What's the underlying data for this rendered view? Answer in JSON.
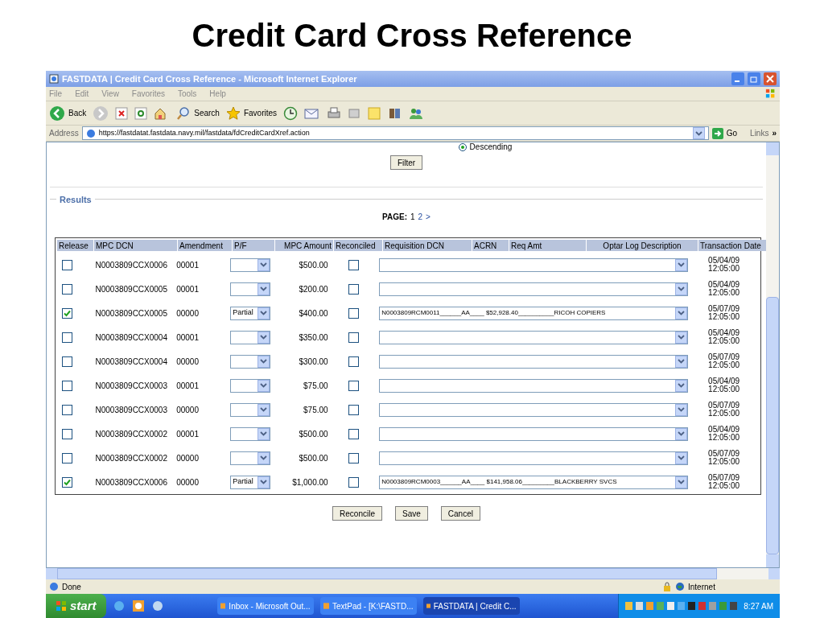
{
  "slide_title": "Credit Card Cross Reference",
  "window": {
    "title": "FASTDATA | Credit Card Cross Reference - Microsoft Internet Explorer"
  },
  "menu": [
    "File",
    "Edit",
    "View",
    "Favorites",
    "Tools",
    "Help"
  ],
  "toolbar": {
    "back": "Back",
    "search": "Search",
    "favorites": "Favorites"
  },
  "address": {
    "label": "Address",
    "url": "https://fastdatat.fastdata.navy.mil/fastdata/fdCreditCardXref.action",
    "go": "Go",
    "links": "Links",
    "more": "»"
  },
  "sort_option": {
    "label": "Descending",
    "selected": true
  },
  "filter_button": "Filter",
  "results": {
    "legend": "Results",
    "page_label": "PAGE:",
    "pages": [
      {
        "label": "1",
        "selected": true
      },
      {
        "label": "2",
        "selected": false
      }
    ],
    "next": ">"
  },
  "columns": [
    "Release",
    "MPC DCN",
    "Amendment",
    "P/F",
    "MPC Amount",
    "Reconciled",
    "Requisition DCN",
    "ACRN",
    "Req Amt",
    "Optar Log Description",
    "Transaction Date"
  ],
  "rows": [
    {
      "release": false,
      "dcn": "N0003809CCX0006",
      "amendment": "00001",
      "amount": "$500.00",
      "reconciled": false,
      "date": "05/04/09",
      "time": "12:05:00"
    },
    {
      "release": false,
      "dcn": "N0003809CCX0005",
      "amendment": "00001",
      "amount": "$200.00",
      "reconciled": false,
      "date": "05/04/09",
      "time": "12:05:00"
    },
    {
      "release": true,
      "dcn": "N0003809CCX0005",
      "amendment": "00000",
      "pf": "Partial",
      "amount": "$400.00",
      "reconciled": false,
      "requisition": "N0003809RCM0011______AA____ $52,928.40__________RICOH COPIERS",
      "date": "05/07/09",
      "time": "12:05:00"
    },
    {
      "release": false,
      "dcn": "N0003809CCX0004",
      "amendment": "00001",
      "amount": "$350.00",
      "reconciled": false,
      "date": "05/04/09",
      "time": "12:05:00"
    },
    {
      "release": false,
      "dcn": "N0003809CCX0004",
      "amendment": "00000",
      "amount": "$300.00",
      "reconciled": false,
      "date": "05/07/09",
      "time": "12:05:00"
    },
    {
      "release": false,
      "dcn": "N0003809CCX0003",
      "amendment": "00001",
      "amount": "$75.00",
      "reconciled": false,
      "date": "05/04/09",
      "time": "12:05:00"
    },
    {
      "release": false,
      "dcn": "N0003809CCX0003",
      "amendment": "00000",
      "amount": "$75.00",
      "reconciled": false,
      "date": "05/07/09",
      "time": "12:05:00"
    },
    {
      "release": false,
      "dcn": "N0003809CCX0002",
      "amendment": "00001",
      "amount": "$500.00",
      "reconciled": false,
      "date": "05/04/09",
      "time": "12:05:00"
    },
    {
      "release": false,
      "dcn": "N0003809CCX0002",
      "amendment": "00000",
      "amount": "$500.00",
      "reconciled": false,
      "date": "05/07/09",
      "time": "12:05:00"
    },
    {
      "release": true,
      "dcn": "N0003809CCX0006",
      "amendment": "00000",
      "pf": "Partial",
      "amount": "$1,000.00",
      "reconciled": false,
      "requisition": "N0003809RCM0003______AA____ $141,958.06_________BLACKBERRY SVCS",
      "date": "05/07/09",
      "time": "12:05:00"
    }
  ],
  "buttons": [
    "Reconcile",
    "Save",
    "Cancel"
  ],
  "status": {
    "text": "Done",
    "zone": "Internet"
  },
  "taskbar": {
    "start": "start",
    "tasks": [
      {
        "label": "Inbox - Microsoft Out...",
        "selected": false
      },
      {
        "label": "TextPad - [K:\\FASTD...",
        "selected": false
      },
      {
        "label": "FASTDATA | Credit C...",
        "selected": true
      }
    ],
    "clock": "8:27 AM"
  }
}
